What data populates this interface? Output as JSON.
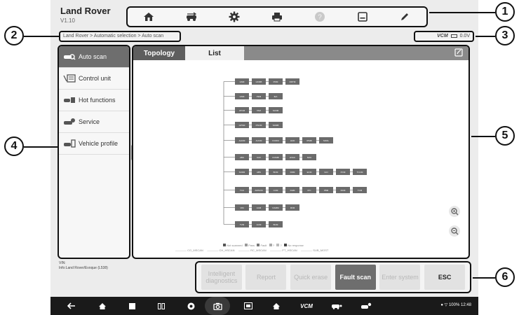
{
  "app": {
    "title": "Land Rover",
    "version": "V1.10"
  },
  "toolbar": {
    "buttons": [
      {
        "name": "home",
        "icon": "home-icon"
      },
      {
        "name": "vehicle-swap",
        "icon": "vehicle-swap-icon"
      },
      {
        "name": "settings",
        "icon": "gear-icon"
      },
      {
        "name": "print",
        "icon": "printer-icon"
      },
      {
        "name": "help",
        "icon": "help-icon"
      },
      {
        "name": "save",
        "icon": "save-icon"
      },
      {
        "name": "edit",
        "icon": "pen-icon"
      }
    ]
  },
  "breadcrumb": "Land Rover > Automatic selection > Auto scan",
  "vcm": {
    "label": "VCM",
    "voltage": "0.0V"
  },
  "sidebar": {
    "items": [
      {
        "label": "Auto scan",
        "icon": "car-scan-icon",
        "active": true
      },
      {
        "label": "Control unit",
        "icon": "control-unit-icon",
        "active": false
      },
      {
        "label": "Hot functions",
        "icon": "hot-functions-icon",
        "active": false
      },
      {
        "label": "Service",
        "icon": "service-icon",
        "active": false
      },
      {
        "label": "Vehicle profile",
        "icon": "vehicle-profile-icon",
        "active": false
      }
    ]
  },
  "tabs": [
    {
      "label": "Topology",
      "active": true
    },
    {
      "label": "List",
      "active": false
    }
  ],
  "topology": {
    "nodes": [
      "GSM",
      "HCMB",
      "PDM",
      "RDTM",
      "GSM",
      "PEM",
      "IEA",
      "ATCM",
      "TAM",
      "SASM",
      "GPSM",
      "PSCM",
      "SDMB",
      "AHCM",
      "AUCM",
      "FCDIM",
      "HUD",
      "IPMB",
      "SODL",
      "ABU",
      "CAV",
      "FCIMB",
      "HVAC",
      "ISAV",
      "SODR",
      "ABS",
      "BCM",
      "DDM",
      "ECM",
      "GCI",
      "PCM",
      "TCCM",
      "TCU",
      "AMSCM",
      "CCM",
      "DHM",
      "IPC",
      "PBM",
      "RCM",
      "TCM",
      "VIM",
      "AAM",
      "DAMM",
      "RFM",
      "TVM",
      "ACM",
      "BCM",
      "DDM"
    ]
  },
  "legend": {
    "status": [
      "Not scanned",
      "Pass",
      "Fault",
      "?",
      "?",
      "No response"
    ],
    "buses": [
      "CO_MSCAN",
      "CH_HSCAN",
      "RC_MSCAN",
      "PT_HSCAN",
      "SUB_MOST"
    ]
  },
  "vehicle_info": {
    "vin_label": "VIN:",
    "info": "Info:Land Rover/Evoque (L538)"
  },
  "actions": [
    {
      "label": "Intelligent diagnostics",
      "style": "disabled"
    },
    {
      "label": "Report",
      "style": "disabled"
    },
    {
      "label": "Quick erase",
      "style": "disabled"
    },
    {
      "label": "Fault scan",
      "style": "primary"
    },
    {
      "label": "Enter system",
      "style": "disabled"
    },
    {
      "label": "ESC",
      "style": "esc"
    }
  ],
  "navbar": {
    "status": "100% 12:48"
  },
  "callouts": [
    "1",
    "2",
    "3",
    "4",
    "5",
    "6"
  ],
  "colors": {
    "active_gray": "#6e6e6e",
    "node_gray": "#6b6b6b",
    "frame": "#ececec"
  }
}
